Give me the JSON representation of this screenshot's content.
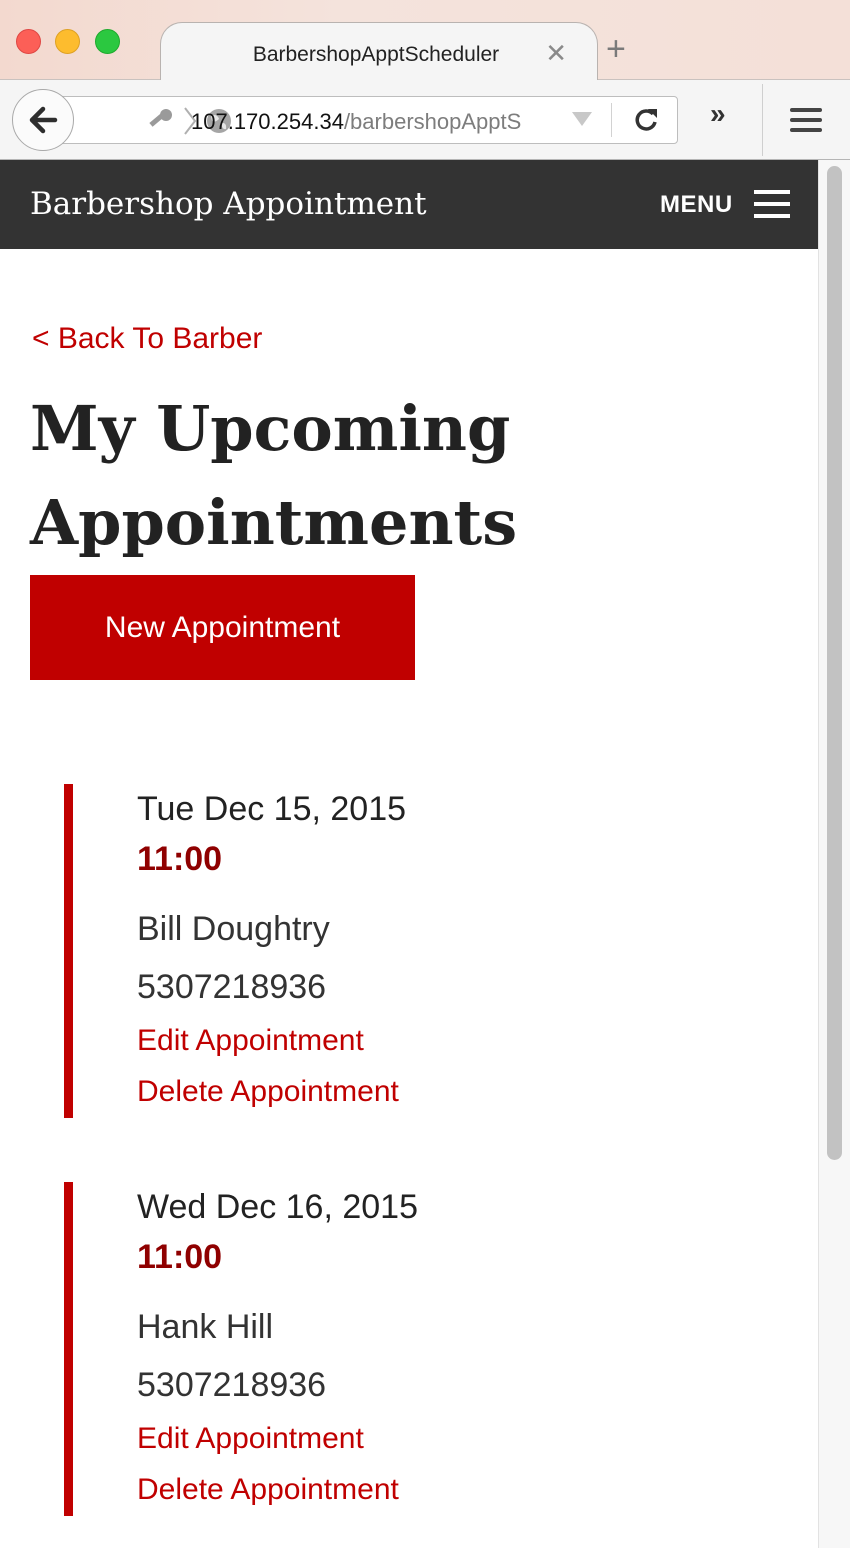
{
  "browser": {
    "tab_title": "BarbershopApptScheduler",
    "tab_close_icon": "close-icon",
    "new_tab_symbol": "+",
    "url_host": "107.170.254.34",
    "url_path": "/barbershopApptS",
    "overflow_symbol": "»"
  },
  "header": {
    "site_title": "Barbershop Appointment",
    "menu_label": "MENU"
  },
  "page": {
    "back_link": "< Back To Barber",
    "title": "My Upcoming Appointments",
    "new_appointment_button": "New Appointment"
  },
  "appointments": [
    {
      "date": "Tue Dec 15, 2015",
      "time": "11:00",
      "name": "Bill Doughtry",
      "phone": "5307218936",
      "edit_label": "Edit Appointment",
      "delete_label": "Delete Appointment"
    },
    {
      "date": "Wed Dec 16, 2015",
      "time": "11:00",
      "name": "Hank Hill",
      "phone": "5307218936",
      "edit_label": "Edit Appointment",
      "delete_label": "Delete Appointment"
    }
  ],
  "colors": {
    "accent": "#c00000",
    "time": "#8f0000",
    "header_bg": "#333333"
  }
}
